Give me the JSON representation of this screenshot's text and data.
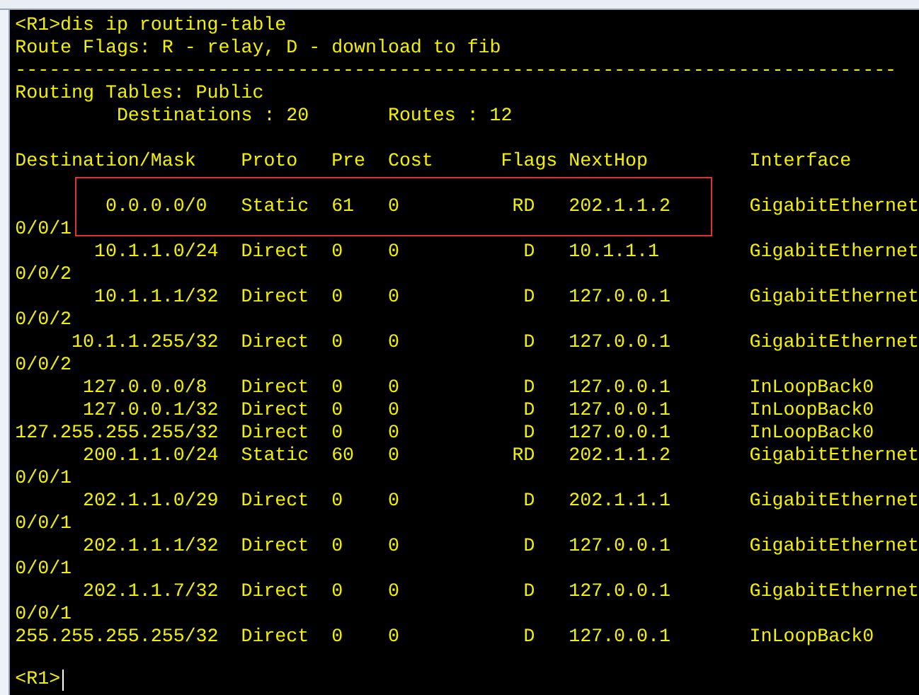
{
  "terminal": {
    "lines": [
      {
        "kind": "text",
        "text": "<R1>dis ip routing-table",
        "highlighted": false
      },
      {
        "kind": "text",
        "text": "Route Flags: R - relay, D - download to fib",
        "highlighted": false
      },
      {
        "kind": "text",
        "text": "------------------------------------------------------------------------------",
        "highlighted": false
      },
      {
        "kind": "text",
        "text": "Routing Tables: Public",
        "highlighted": false
      },
      {
        "kind": "text",
        "text": "         Destinations : 20       Routes : 12",
        "highlighted": false
      },
      {
        "kind": "blank"
      },
      {
        "kind": "text",
        "text": "Destination/Mask    Proto   Pre  Cost      Flags NextHop         Interface",
        "highlighted": false
      },
      {
        "kind": "blank"
      },
      {
        "kind": "text",
        "text": "        0.0.0.0/0   Static  61   0          RD   202.1.1.2       GigabitEthernet",
        "highlighted": true
      },
      {
        "kind": "text",
        "text": "0/0/1",
        "highlighted": false
      },
      {
        "kind": "text",
        "text": "       10.1.1.0/24  Direct  0    0           D   10.1.1.1        GigabitEthernet",
        "highlighted": false
      },
      {
        "kind": "text",
        "text": "0/0/2",
        "highlighted": false
      },
      {
        "kind": "text",
        "text": "       10.1.1.1/32  Direct  0    0           D   127.0.0.1       GigabitEthernet",
        "highlighted": false
      },
      {
        "kind": "text",
        "text": "0/0/2",
        "highlighted": false
      },
      {
        "kind": "text",
        "text": "     10.1.1.255/32  Direct  0    0           D   127.0.0.1       GigabitEthernet",
        "highlighted": false
      },
      {
        "kind": "text",
        "text": "0/0/2",
        "highlighted": false
      },
      {
        "kind": "text",
        "text": "      127.0.0.0/8   Direct  0    0           D   127.0.0.1       InLoopBack0",
        "highlighted": false
      },
      {
        "kind": "text",
        "text": "      127.0.0.1/32  Direct  0    0           D   127.0.0.1       InLoopBack0",
        "highlighted": false
      },
      {
        "kind": "text",
        "text": "127.255.255.255/32  Direct  0    0           D   127.0.0.1       InLoopBack0",
        "highlighted": false
      },
      {
        "kind": "text",
        "text": "      200.1.1.0/24  Static  60   0          RD   202.1.1.2       GigabitEthernet",
        "highlighted": false
      },
      {
        "kind": "text",
        "text": "0/0/1",
        "highlighted": false
      },
      {
        "kind": "text",
        "text": "      202.1.1.0/29  Direct  0    0           D   202.1.1.1       GigabitEthernet",
        "highlighted": false
      },
      {
        "kind": "text",
        "text": "0/0/1",
        "highlighted": false
      },
      {
        "kind": "text",
        "text": "      202.1.1.1/32  Direct  0    0           D   127.0.0.1       GigabitEthernet",
        "highlighted": false
      },
      {
        "kind": "text",
        "text": "0/0/1",
        "highlighted": false
      },
      {
        "kind": "text",
        "text": "      202.1.1.7/32  Direct  0    0           D   127.0.0.1       GigabitEthernet",
        "highlighted": false
      },
      {
        "kind": "text",
        "text": "0/0/1",
        "highlighted": false
      },
      {
        "kind": "text",
        "text": "255.255.255.255/32  Direct  0    0           D   127.0.0.1       InLoopBack0",
        "highlighted": false
      },
      {
        "kind": "blank"
      },
      {
        "kind": "prompt",
        "text": "<R1>"
      }
    ]
  }
}
